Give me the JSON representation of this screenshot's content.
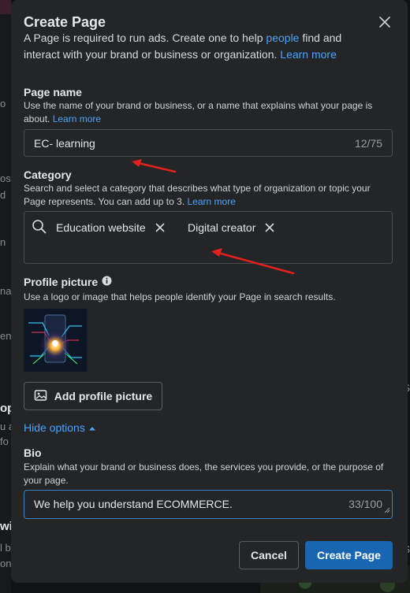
{
  "background": {
    "fragments_left": [
      "o",
      "os",
      "d",
      "n",
      "na",
      "en",
      "op",
      "u a",
      "fo",
      "wit",
      "l b",
      "ons"
    ],
    "fragments_right": [
      "S",
      "S"
    ]
  },
  "modal": {
    "title": "Create Page",
    "intro": {
      "text_before": "A Page is required to run ads. Create one to help ",
      "link_people": "people",
      "text_middle": " find and interact with your brand or business or organization. ",
      "link_learn": "Learn more"
    },
    "page_name": {
      "label": "Page name",
      "help": "Use the name of your brand or business, or a name that explains what your page is about. ",
      "help_link": "Learn more",
      "value": "EC- learning",
      "counter": "12/75"
    },
    "category": {
      "label": "Category",
      "help": "Search and select a category that describes what type of organization or topic your Page represents. You can add up to 3. ",
      "help_link": "Learn more",
      "chips": [
        "Education website",
        "Digital creator"
      ]
    },
    "profile_picture": {
      "label": "Profile picture",
      "help": "Use a logo or image that helps people identify your Page in search results.",
      "button_label": "Add profile picture"
    },
    "hide_options_label": "Hide options",
    "bio": {
      "label": "Bio",
      "help": "Explain what your brand or business does, the services you provide, or the purpose of your page.",
      "value": "We help you understand ECOMMERCE.",
      "counter": "33/100"
    },
    "cancel_label": "Cancel",
    "create_label": "Create Page"
  },
  "icons": {
    "close": "close-icon",
    "search": "search-icon",
    "remove": "remove-chip-icon",
    "info": "info-icon",
    "image_add": "image-add-icon",
    "caret_up": "caret-up-icon"
  },
  "colors": {
    "accent_link": "#4aa3ff",
    "primary_button": "#1866b1",
    "annotation_arrow": "#e0211d"
  }
}
